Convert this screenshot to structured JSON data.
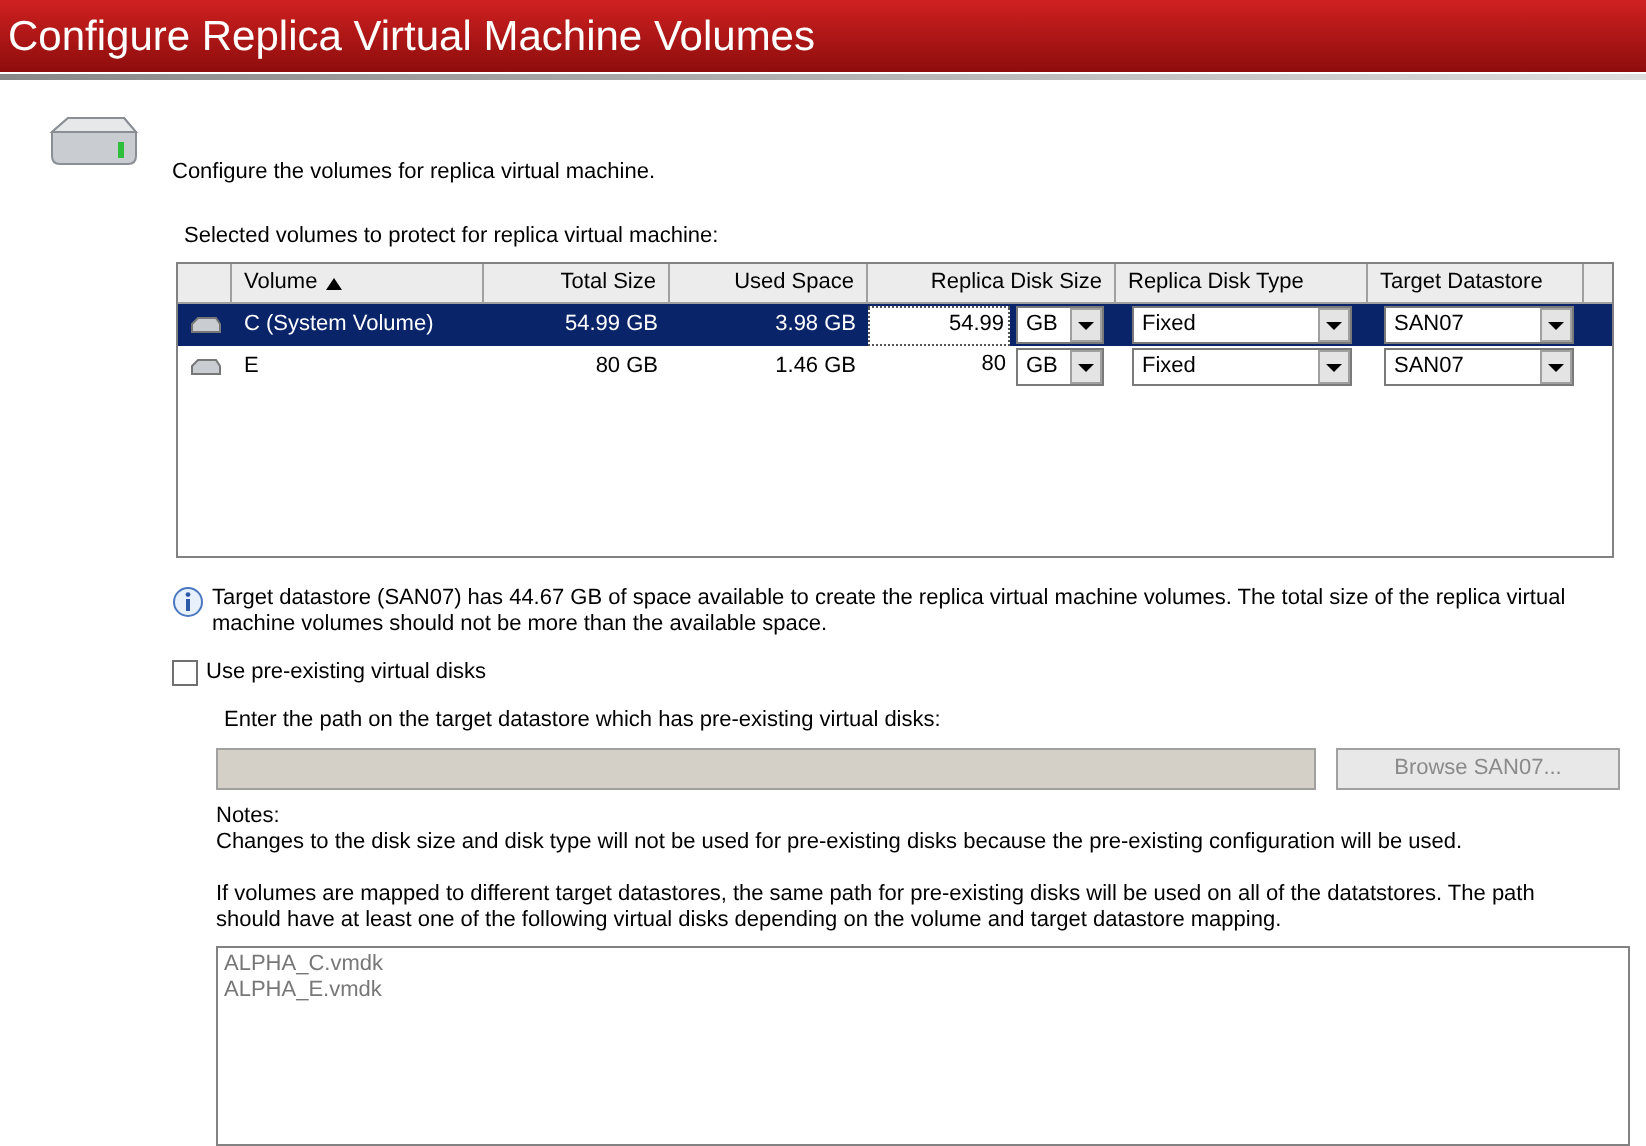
{
  "title": "Configure Replica Virtual Machine Volumes",
  "intro": "Configure the volumes for replica virtual machine.",
  "table_label": "Selected volumes to protect for replica virtual machine:",
  "table": {
    "columns": [
      {
        "label": "Volume",
        "sorted": true
      },
      {
        "label": "Total Size",
        "sorted": false
      },
      {
        "label": "Used Space",
        "sorted": false
      },
      {
        "label": "Replica Disk Size",
        "sorted": false
      },
      {
        "label": "Replica Disk Type",
        "sorted": false
      },
      {
        "label": "Target Datastore",
        "sorted": false
      }
    ],
    "rows": [
      {
        "selected": true,
        "volume": "C (System Volume)",
        "total_size": "54.99 GB",
        "used_space": "3.98 GB",
        "replica_size": "54.99",
        "unit": "GB",
        "disk_type": "Fixed",
        "datastore": "SAN07"
      },
      {
        "selected": false,
        "volume": "E",
        "total_size": "80 GB",
        "used_space": "1.46 GB",
        "replica_size": "80",
        "unit": "GB",
        "disk_type": "Fixed",
        "datastore": "SAN07"
      }
    ]
  },
  "info": "Target datastore (SAN07) has 44.67 GB of space available to create the replica virtual machine volumes. The total size of the replica virtual machine volumes should not be more than the available space.",
  "use_existing": {
    "label": "Use pre-existing virtual disks",
    "checked": false
  },
  "path_label": "Enter the path on the target datastore which has pre-existing virtual disks:",
  "path_field": {
    "disabled": true
  },
  "browse_button": {
    "label": "Browse SAN07...",
    "disabled": true
  },
  "notes_heading": "Notes:",
  "notes": [
    "Changes to the disk size and disk type will not be used for pre-existing disks because the pre-existing configuration will be used.",
    "If volumes are mapped to different target datastores, the same path for pre-existing disks will be used on all of the datatstores. The path should have at least one of the following virtual disks depending on the volume and target datastore mapping."
  ],
  "disk_list": [
    "ALPHA_C.vmdk",
    "ALPHA_E.vmdk"
  ]
}
